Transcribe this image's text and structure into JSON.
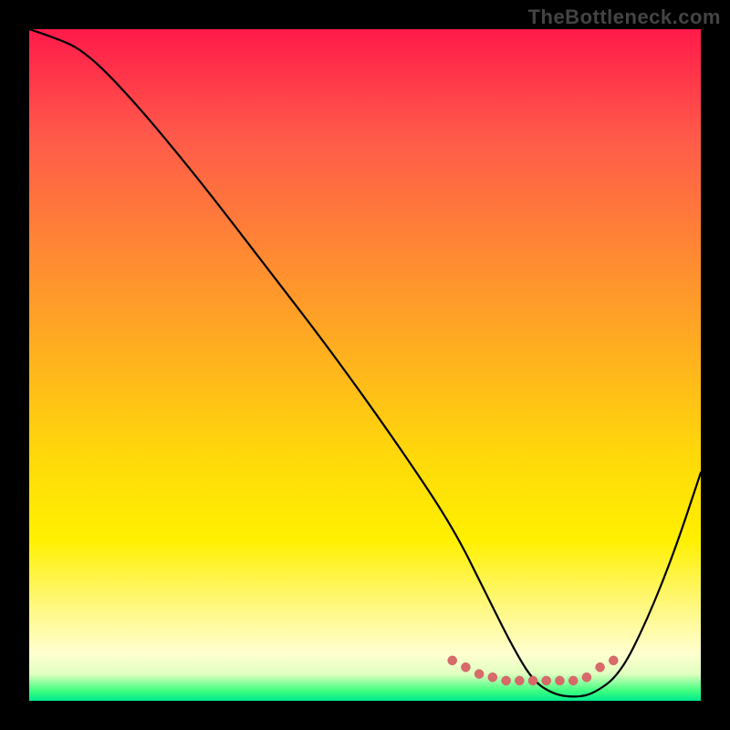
{
  "watermark": "TheBottleneck.com",
  "chart_data": {
    "type": "line",
    "title": "",
    "xlabel": "",
    "ylabel": "",
    "xlim": [
      0,
      100
    ],
    "ylim": [
      0,
      100
    ],
    "grid": false,
    "legend": false,
    "background": "gradient",
    "gradient_stops": [
      {
        "pos": 0,
        "color": "#ff1a4a"
      },
      {
        "pos": 50,
        "color": "#ffda0a"
      },
      {
        "pos": 95,
        "color": "#ffffd0"
      },
      {
        "pos": 100,
        "color": "#00e890"
      }
    ],
    "series": [
      {
        "name": "bottleneck-curve",
        "x": [
          0,
          3,
          8,
          15,
          25,
          35,
          45,
          55,
          63,
          68,
          72,
          75,
          78,
          81,
          84,
          88,
          92,
          96,
          100
        ],
        "y": [
          100,
          99,
          97,
          90,
          78,
          65,
          52,
          38,
          26,
          16,
          8,
          3,
          1,
          0.5,
          1,
          4,
          12,
          22,
          34
        ]
      }
    ],
    "markers": {
      "name": "optimal-range",
      "x": [
        63,
        65,
        67,
        69,
        71,
        73,
        75,
        77,
        79,
        81,
        83,
        85,
        87
      ],
      "y": [
        6,
        5,
        4,
        3.5,
        3,
        3,
        3,
        3,
        3,
        3,
        3.5,
        5,
        6
      ]
    }
  }
}
